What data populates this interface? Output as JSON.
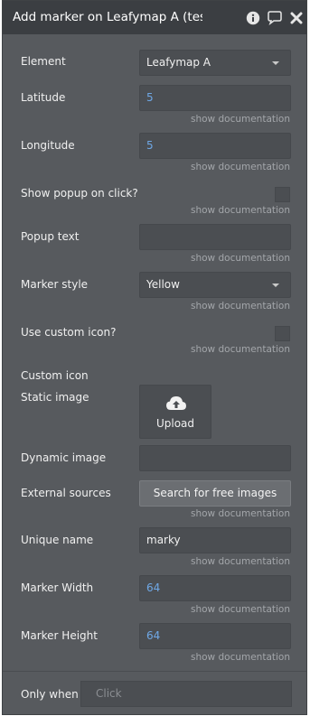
{
  "header": {
    "title": "Add marker on Leafymap A (test"
  },
  "fields": {
    "element": {
      "label": "Element",
      "value": "Leafymap A"
    },
    "latitude": {
      "label": "Latitude",
      "value": "5",
      "doc": "show documentation"
    },
    "longitude": {
      "label": "Longitude",
      "value": "5",
      "doc": "show documentation"
    },
    "show_popup": {
      "label": "Show popup on click?",
      "doc": "show documentation"
    },
    "popup_text": {
      "label": "Popup text",
      "value": "",
      "doc": "show documentation"
    },
    "marker_style": {
      "label": "Marker style",
      "value": "Yellow",
      "doc": "show documentation"
    },
    "custom_icon_toggle": {
      "label": "Use custom icon?",
      "doc": "show documentation"
    },
    "custom_icon": {
      "label": "Custom icon"
    },
    "static_image": {
      "label": "Static image",
      "button": "Upload"
    },
    "dynamic_image": {
      "label": "Dynamic image",
      "value": ""
    },
    "external_sources": {
      "label": "External sources",
      "button": "Search for free images",
      "doc": "show documentation"
    },
    "unique_name": {
      "label": "Unique name",
      "value": "marky",
      "doc": "show documentation"
    },
    "marker_width": {
      "label": "Marker Width",
      "value": "64",
      "doc": "show documentation"
    },
    "marker_height": {
      "label": "Marker Height",
      "value": "64",
      "doc": "show documentation"
    }
  },
  "footer": {
    "label": "Only when",
    "placeholder": "Click"
  }
}
